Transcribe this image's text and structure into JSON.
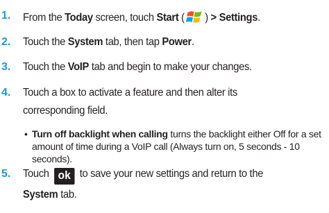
{
  "steps": [
    {
      "number": "1.",
      "pre": "From the ",
      "bold1": "Today",
      "mid1": " screen, touch ",
      "bold2": "Start",
      "mid2": " (",
      "mid3": ") ",
      "bold3": "> Settings",
      "post": ".",
      "icon": "windows-start-logo-icon"
    },
    {
      "number": "2.",
      "pre": "Touch the ",
      "bold1": "System",
      "mid1": " tab, then tap ",
      "bold2": "Power",
      "post": "."
    },
    {
      "number": "3.",
      "pre": "Touch the ",
      "bold1": "VoIP",
      "post": " tab and begin to make your changes."
    },
    {
      "number": "4.",
      "line1": "Touch a box to activate a feature and then alter its",
      "line2": "corresponding field."
    },
    {
      "number": "5.",
      "pre": "Touch",
      "key": "ok",
      "post": "to save your new settings and return to the",
      "line2_bold": "System",
      "line2_post": " tab."
    }
  ],
  "bullet": {
    "symbol": "•",
    "bold": "Turn off backlight when calling",
    "text": " turns the backlight either Off for a set amount of time during a VoIP call (Always turn on, 5 seconds - 10 seconds)."
  },
  "colors": {
    "step_number": "#1a9ad6",
    "text": "#231f20",
    "ok_key_bg": "#231f20"
  }
}
